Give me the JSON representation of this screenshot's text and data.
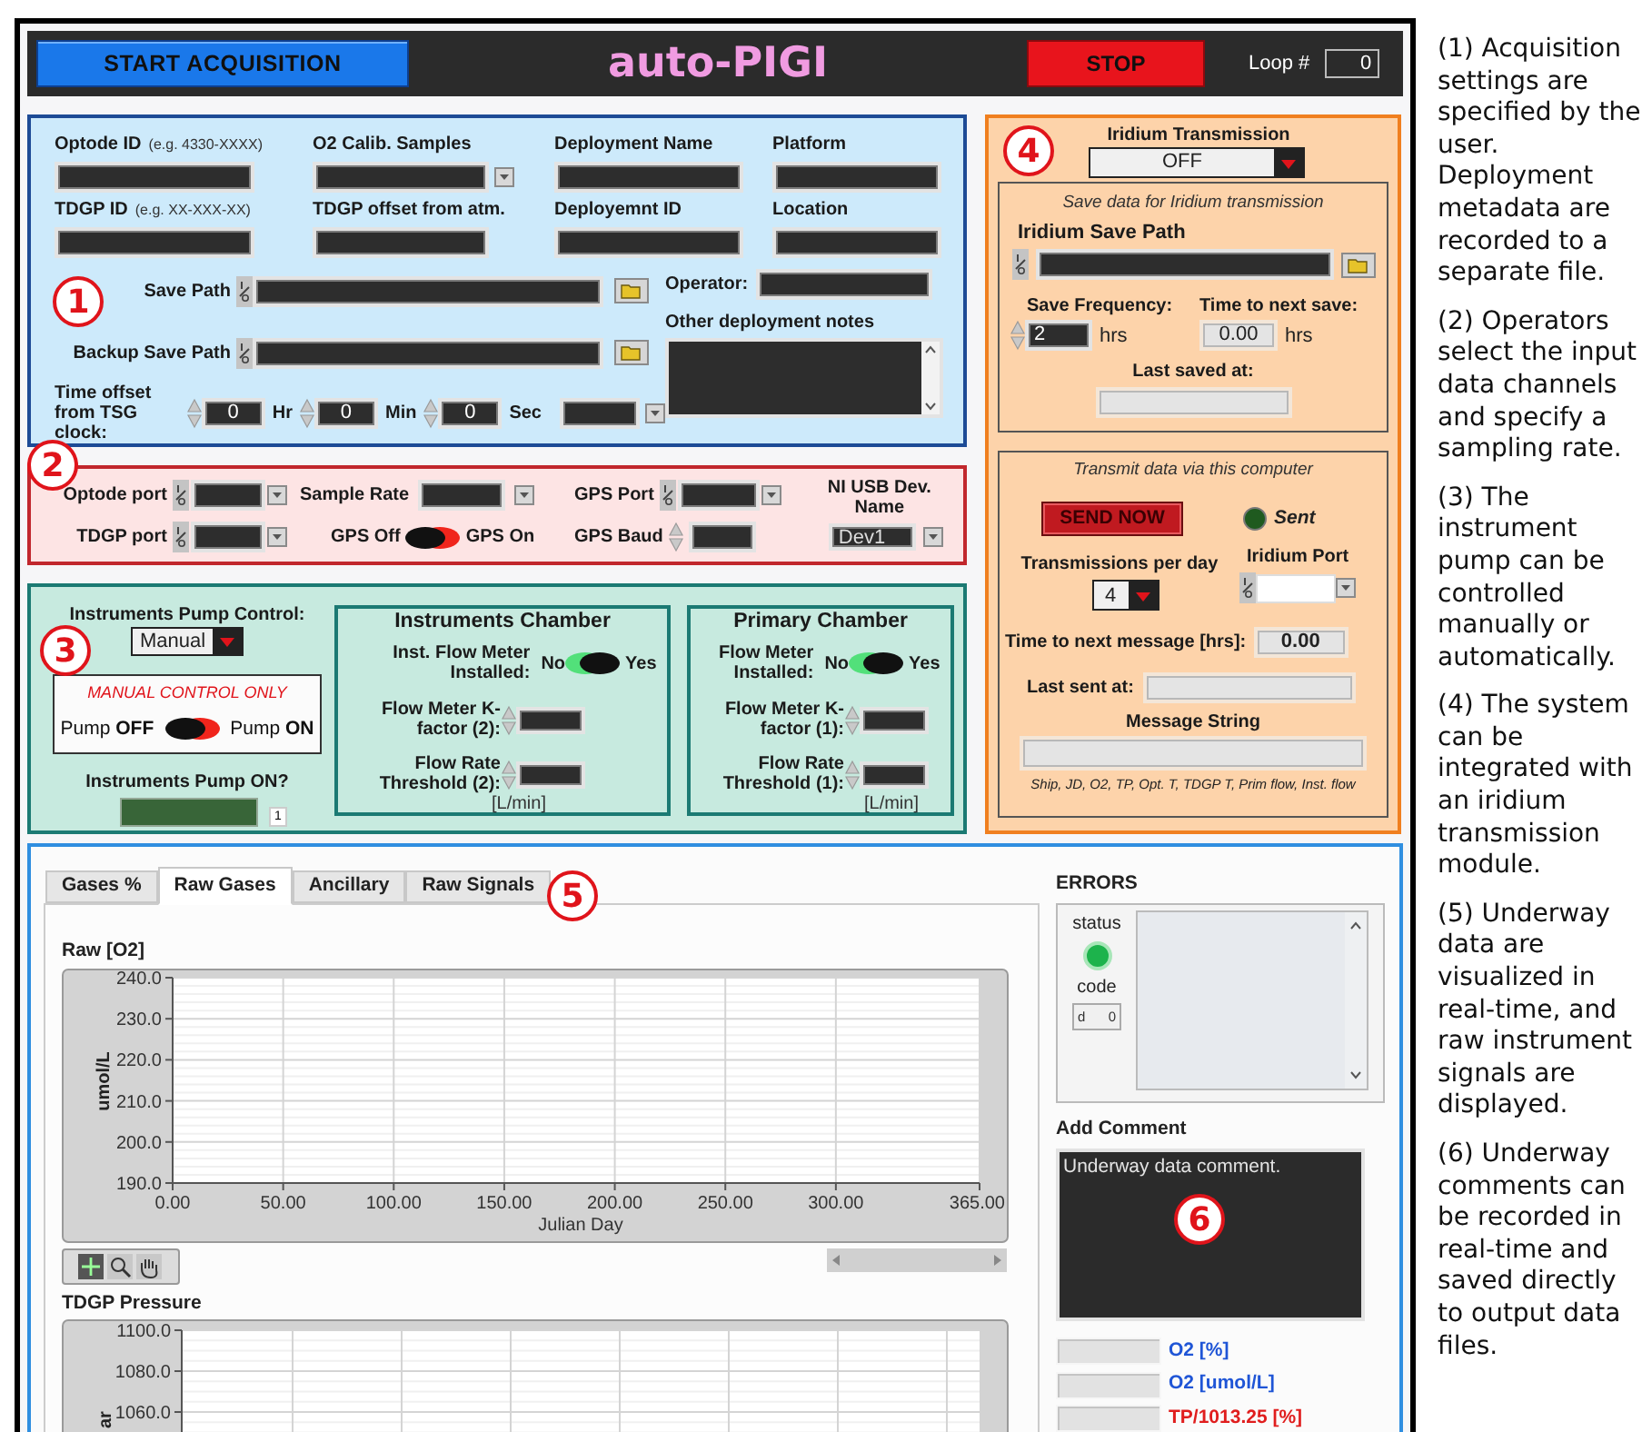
{
  "header": {
    "start_button": "START ACQUISITION",
    "title": "auto-PIGI",
    "stop_button": "STOP",
    "loop_label": "Loop #",
    "loop_value": "0"
  },
  "acquisition": {
    "marker": "1",
    "fields": [
      {
        "label": "Optode ID",
        "hint": "(e.g. 4330-XXXX)",
        "kind": "text"
      },
      {
        "label": "O2 Calib. Samples",
        "kind": "dropdown"
      },
      {
        "label": "Deployment Name",
        "kind": "text"
      },
      {
        "label": "Platform",
        "kind": "text"
      },
      {
        "label": "TDGP ID",
        "hint": "(e.g. XX-XXX-XX)",
        "kind": "text"
      },
      {
        "label": "TDGP offset from atm.",
        "kind": "text"
      },
      {
        "label": "Deployemnt ID",
        "kind": "text"
      },
      {
        "label": "Location",
        "kind": "text"
      }
    ],
    "paths": [
      {
        "label": "Save Path"
      },
      {
        "label": "Backup Save Path"
      }
    ],
    "time_offset": {
      "label": "Time offset from TSG clock:",
      "parts": [
        {
          "value": "0",
          "unit": "Hr"
        },
        {
          "value": "0",
          "unit": "Min"
        },
        {
          "value": "0",
          "unit": "Sec"
        }
      ]
    },
    "operator": {
      "label": "Operator:"
    },
    "notes": {
      "label": "Other deployment notes"
    }
  },
  "io": {
    "marker": "2",
    "optode_port": {
      "label": "Optode port"
    },
    "sample_rate": {
      "label": "Sample Rate"
    },
    "gps_port": {
      "label": "GPS Port"
    },
    "usb_device": {
      "label": "NI USB Dev. Name",
      "value": "Dev1"
    },
    "tdgp_port": {
      "label": "TDGP port"
    },
    "gps_switch": {
      "off_label": "GPS Off",
      "on_label": "GPS On",
      "on": false
    },
    "gps_baud": {
      "label": "GPS Baud"
    }
  },
  "pump": {
    "marker": "3",
    "control_label": "Instruments Pump Control:",
    "control_value": "Manual",
    "manual_caption": "MANUAL CONTROL ONLY",
    "switch": {
      "off_label": "Pump **OFF**",
      "on_label": "Pump **ON**",
      "on": false
    },
    "indicator_label": "Instruments Pump ON?",
    "indicator_on": false,
    "indicator_value": "1"
  },
  "chambers": [
    {
      "title": "Instruments Chamber",
      "meter_label": "Inst. Flow Meter Installed:",
      "no_label": "No",
      "yes_label": "Yes",
      "installed": true,
      "kfactor_label": "Flow Meter K-factor (2):",
      "threshold_label": "Flow Rate Threshold (2):",
      "unit": "[L/min]"
    },
    {
      "title": "Primary Chamber",
      "meter_label": "Flow Meter Installed:",
      "no_label": "No",
      "yes_label": "Yes",
      "installed": true,
      "kfactor_label": "Flow Meter K-factor (1):",
      "threshold_label": "Flow Rate Threshold (1):",
      "unit": "[L/min]"
    }
  ],
  "iridium": {
    "marker": "4",
    "label": "Iridium Transmission",
    "mode": "OFF",
    "save": {
      "caption": "Save data for Iridium transmission",
      "path_label": "Iridium Save Path",
      "frequency_label": "Save Frequency:",
      "frequency_value": "2",
      "frequency_unit": "hrs",
      "next_save_label": "Time to next save:",
      "next_save_value": "0.00",
      "next_save_unit": "hrs",
      "last_saved_label": "Last saved at:"
    },
    "transmit": {
      "caption": "Transmit data via this computer",
      "send_button": "SEND NOW",
      "sent_label": "Sent",
      "sent": false,
      "per_day_label": "Transmissions per day",
      "per_day_value": "4",
      "port_label": "Iridium Port",
      "next_message_label": "Time to next message [hrs]:",
      "next_message_value": "0.00",
      "last_sent_label": "Last sent at:",
      "message_label": "Message String",
      "message_format": "Ship, JD, O2, TP, Opt. T, TDGP T, Prim flow, Inst. flow"
    }
  },
  "display": {
    "marker": "5",
    "tabs": [
      {
        "label": "Gases %",
        "selected": false
      },
      {
        "label": "Raw Gases",
        "selected": true
      },
      {
        "label": "Ancillary",
        "selected": false
      },
      {
        "label": "Raw Signals",
        "selected": false
      }
    ],
    "charts": [
      {
        "chart_data": {
          "type": "line",
          "grid": true,
          "title": "Raw [O2]",
          "xlabel": "Julian Day",
          "ylabel": "umol/L",
          "xlim": [
            0,
            365
          ],
          "ylim": [
            190,
            240
          ],
          "xticks": [
            {
              "value": 0,
              "label": "0.00"
            },
            {
              "value": 50,
              "label": "50.00"
            },
            {
              "value": 100,
              "label": "100.00"
            },
            {
              "value": 150,
              "label": "150.00"
            },
            {
              "value": 200,
              "label": "200.00"
            },
            {
              "value": 250,
              "label": "250.00"
            },
            {
              "value": 300,
              "label": "300.00"
            },
            {
              "value": 365,
              "label": "365.00"
            }
          ],
          "yticks": [
            {
              "value": 190,
              "label": "190.0"
            },
            {
              "value": 200,
              "label": "200.0"
            },
            {
              "value": 210,
              "label": "210.0"
            },
            {
              "value": 220,
              "label": "220.0"
            },
            {
              "value": 230,
              "label": "230.0"
            },
            {
              "value": 240,
              "label": "240.0"
            }
          ]
        }
      },
      {
        "title": "TDGP Pressure",
        "ylabel": "ar",
        "ytick_labels": [
          "1100.0",
          "1080.0",
          "1060.0"
        ]
      }
    ],
    "errors": {
      "title": "ERRORS",
      "status_label": "status",
      "status_ok": true,
      "code_label": "code",
      "code_radix": "d",
      "code_value": "0"
    },
    "comment": {
      "label": "Add Comment",
      "value": "Underway data comment.",
      "marker": "6"
    },
    "legend": [
      {
        "label": "O2 [%]",
        "color": "#1f55d6"
      },
      {
        "label": "O2 [umol/L]",
        "color": "#1f55d6"
      },
      {
        "label": "TP/1013.25 [%]",
        "color": "#e01e1e"
      }
    ]
  },
  "notes": [
    "(1) Acquisition settings are specified by the user. Deployment metadata are recorded to a separate file.",
    "(2) Operators select the input data channels and specify a sampling rate.",
    "(3) The instrument pump can be controlled manually or automatically.",
    "(4) The system can be integrated with an iridium transmission module.",
    "(5) Underway data are visualized in real-time, and raw instrument signals are displayed.",
    "(6) Underway comments can be recorded in real-time and saved directly to output data files."
  ]
}
